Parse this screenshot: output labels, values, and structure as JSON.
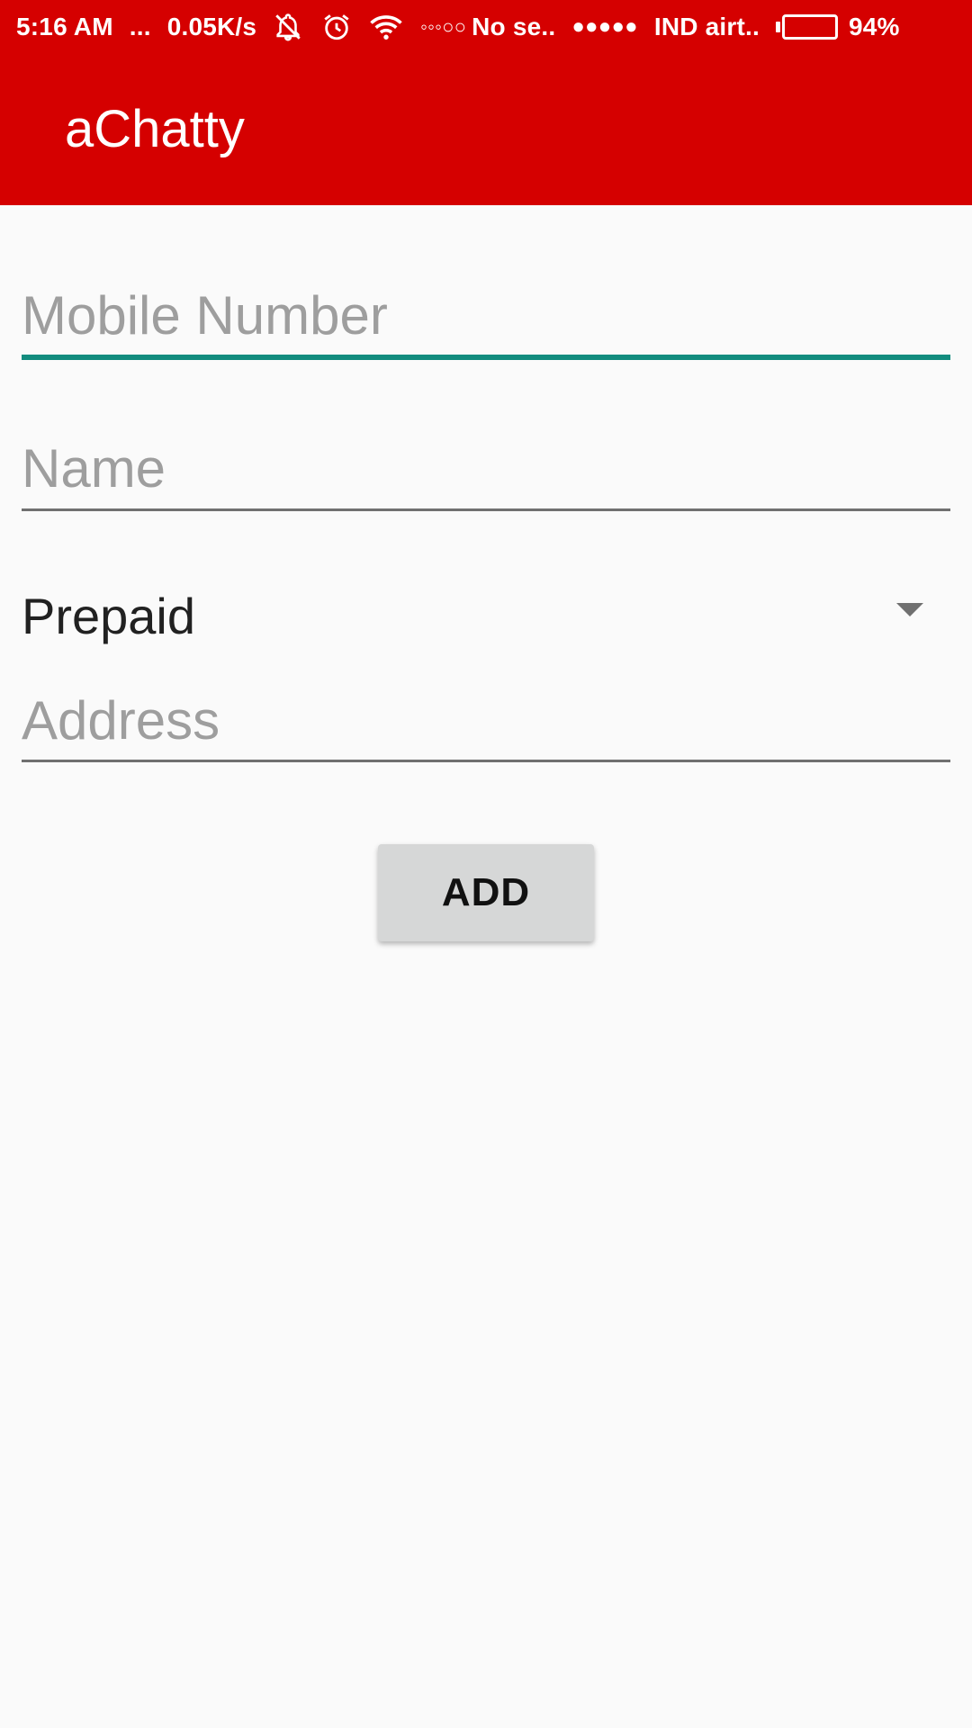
{
  "status_bar": {
    "time": "5:16 AM",
    "dots": "...",
    "speed": "0.05K/s",
    "sim1_signal": "◦◦◦○○",
    "sim1_text": "No se..",
    "sim2_signal": "●●●●●",
    "sim2_text": "IND airt..",
    "battery_percent": "94%",
    "battery_level": 0.94,
    "icons": [
      "bell-off-icon",
      "alarm-icon",
      "wifi-icon"
    ]
  },
  "app_bar": {
    "title": "aChatty",
    "color": "#d50000"
  },
  "form": {
    "mobile_placeholder": "Mobile Number",
    "name_placeholder": "Name",
    "plan_selected": "Prepaid",
    "address_placeholder": "Address",
    "add_button_label": "ADD",
    "focus_color": "#128c7e"
  }
}
